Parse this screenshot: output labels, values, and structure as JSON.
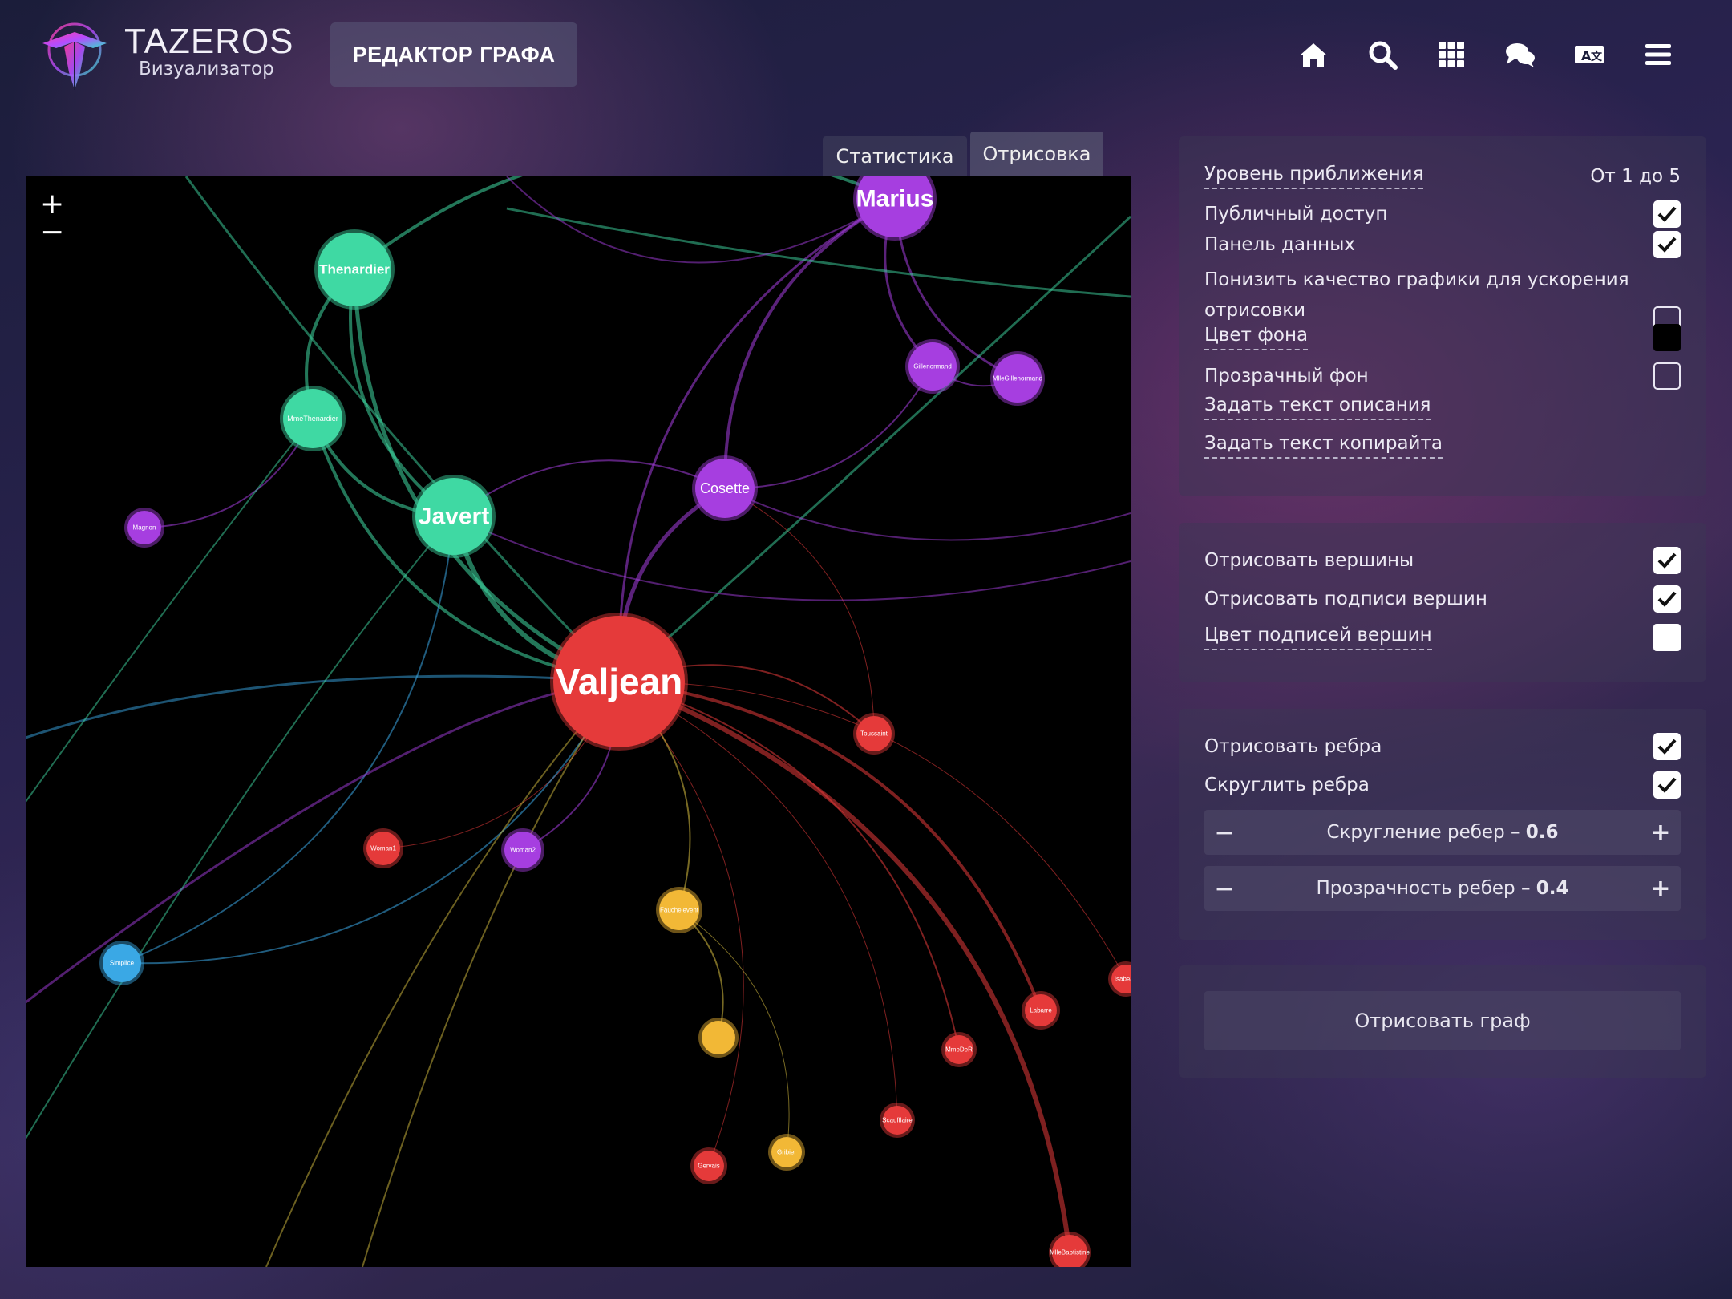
{
  "header": {
    "brand": "TAZEROS",
    "subtitle": "Визуализатор",
    "editor_button": "РЕДАКТОР ГРАФА",
    "nav_icons": [
      "home-icon",
      "search-icon",
      "grid-icon",
      "chat-icon",
      "translate-icon",
      "menu-icon"
    ]
  },
  "tabs": [
    {
      "label": "Статистика",
      "active": false
    },
    {
      "label": "Отрисовка",
      "active": true
    }
  ],
  "graph": {
    "zoom_in": "+",
    "zoom_out": "−",
    "background": "#000000",
    "nodes": [
      {
        "label": "Marius",
        "color": "#a63ee0"
      },
      {
        "label": "Thenardier",
        "color": "#3fd9a3"
      },
      {
        "label": "Gillenormand",
        "color": "#a63ee0"
      },
      {
        "label": "MlleGillenormand",
        "color": "#a63ee0"
      },
      {
        "label": "MmeThenardier",
        "color": "#3fd9a3"
      },
      {
        "label": "Magnon",
        "color": "#a63ee0"
      },
      {
        "label": "Javert",
        "color": "#3fd9a3"
      },
      {
        "label": "Cosette",
        "color": "#a63ee0"
      },
      {
        "label": "Valjean",
        "color": "#e53a3a"
      },
      {
        "label": "Toussaint",
        "color": "#e53a3a"
      },
      {
        "label": "Woman1",
        "color": "#e53a3a"
      },
      {
        "label": "Woman2",
        "color": "#a63ee0"
      },
      {
        "label": "Fauchelevent",
        "color": "#f2b836"
      },
      {
        "label": "Simplice",
        "color": "#3aa8e5"
      },
      {
        "label": "Isabeau",
        "color": "#e53a3a"
      },
      {
        "label": "Labarre",
        "color": "#e53a3a"
      },
      {
        "label": "",
        "color": "#f2b836"
      },
      {
        "label": "MmeDeR",
        "color": "#e53a3a"
      },
      {
        "label": "Scaufflaire",
        "color": "#e53a3a"
      },
      {
        "label": "Gervais",
        "color": "#e53a3a"
      },
      {
        "label": "Gribier",
        "color": "#f2b836"
      },
      {
        "label": "MlleBaptistine",
        "color": "#e53a3a"
      }
    ]
  },
  "settings_panel": {
    "zoom_level_label": "Уровень приближения",
    "zoom_level_value": "От 1 до 5",
    "public_access_label": "Публичный доступ",
    "public_access": true,
    "data_panel_label": "Панель данных",
    "data_panel": true,
    "lower_quality_label_1": "Понизить качество графики для ускорения",
    "lower_quality_label_2": "отрисовки",
    "lower_quality": false,
    "bg_color_label": "Цвет фона",
    "bg_color": "#000000",
    "transparent_bg_label": "Прозрачный фон",
    "transparent_bg": false,
    "description_label": "Задать текст описания",
    "copyright_label": "Задать текст копирайта"
  },
  "nodes_panel": {
    "draw_nodes_label": "Отрисовать вершины",
    "draw_nodes": true,
    "draw_node_labels_label": "Отрисовать подписи вершин",
    "draw_node_labels": true,
    "label_color_label": "Цвет подписей вершин",
    "label_color": "#ffffff"
  },
  "edges_panel": {
    "draw_edges_label": "Отрисовать ребра",
    "draw_edges": true,
    "round_edges_label": "Скруглить ребра",
    "round_edges": true,
    "rounding_label": "Скругление ребер –",
    "rounding_value": "0.6",
    "opacity_label": "Прозрачность ребер –",
    "opacity_value": "0.4",
    "minus": "−",
    "plus": "+"
  },
  "render_button": "Отрисовать граф"
}
